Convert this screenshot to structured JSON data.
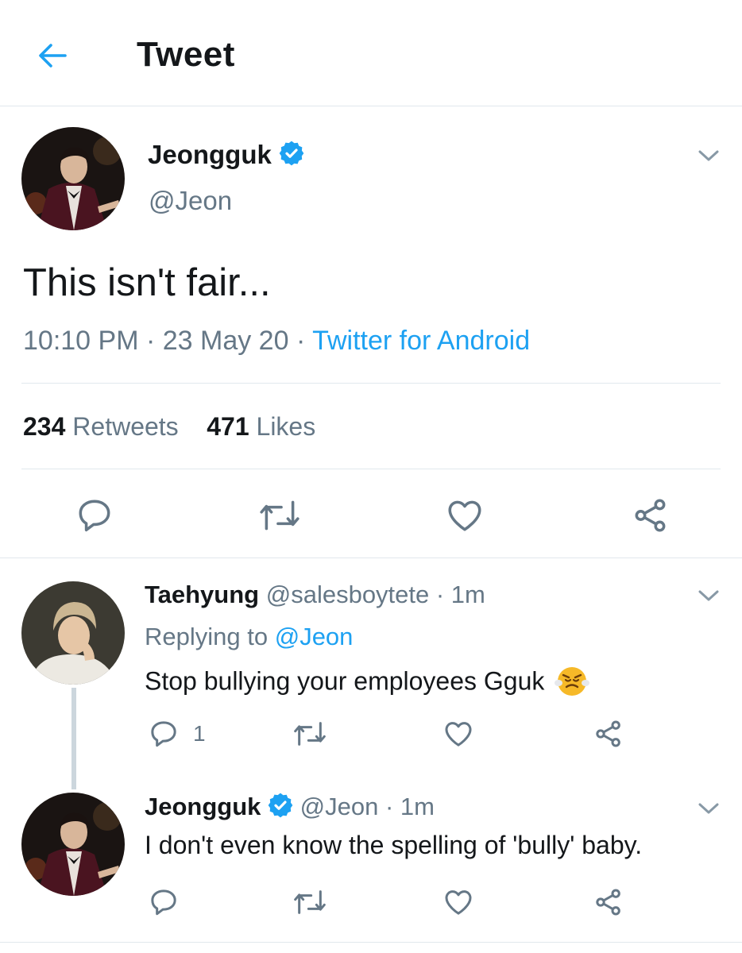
{
  "header": {
    "title": "Tweet",
    "back_icon": "arrow-left-icon"
  },
  "colors": {
    "accent": "#1da1f2",
    "secondary_text": "#657786",
    "divider": "#e1e8ed",
    "text": "#14171a"
  },
  "main_tweet": {
    "name": "Jeongguk",
    "handle": "@Jeon",
    "text": "This isn't fair...",
    "time": "10:10 PM · 23 May 20 · ",
    "source": "Twitter for Android",
    "retweets_count": "234",
    "retweets_label": "Retweets",
    "likes_count": "471",
    "likes_label": "Likes",
    "actions": [
      "reply-icon",
      "retweet-icon",
      "like-icon",
      "share-icon"
    ]
  },
  "replies": [
    {
      "name": "Taehyung",
      "handle": "@salesboytete · 1m",
      "replying_label": "Replying to ",
      "replying_mention": "@Jeon",
      "text": "Stop bullying your employees Gguk",
      "emoji": "angry-face-emoji",
      "reply_count": "1"
    },
    {
      "name": "Jeongguk",
      "handle": "@Jeon · 1m",
      "text": "I don't even know the spelling of 'bully' baby."
    }
  ]
}
